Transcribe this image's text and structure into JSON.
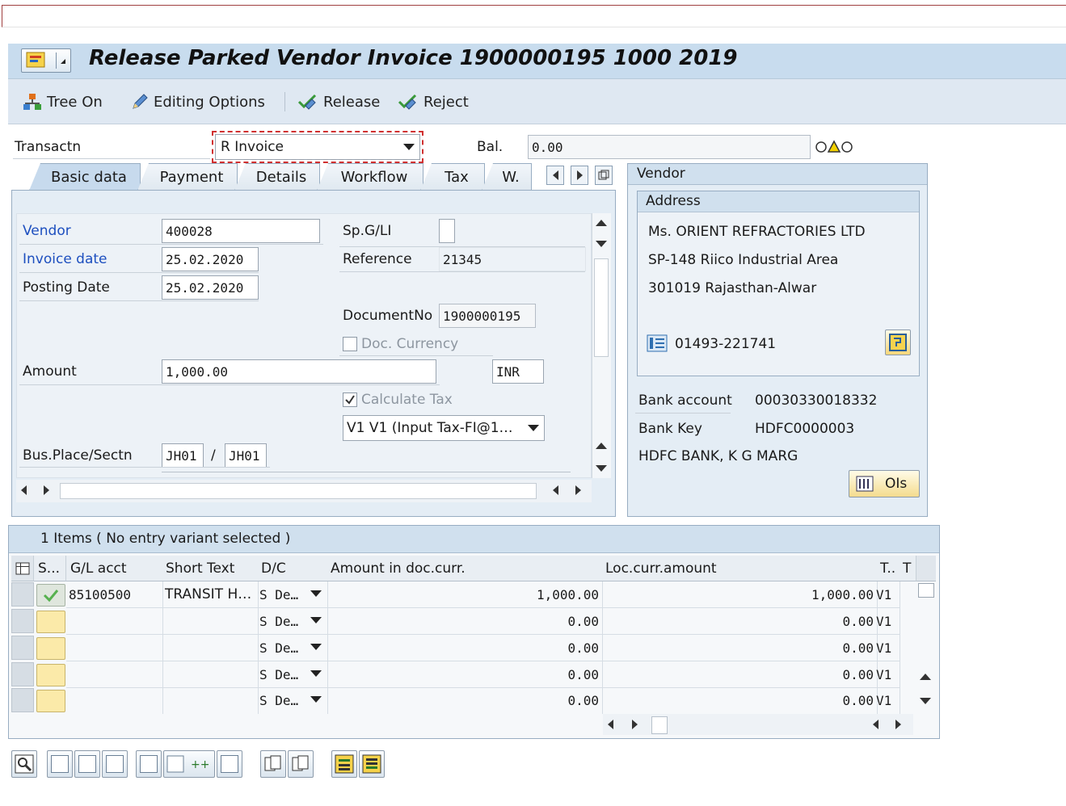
{
  "title": "Release Parked Vendor Invoice 1900000195 1000 2019",
  "toolbar": {
    "tree_on": "Tree On",
    "editing_options": "Editing Options",
    "release": "Release",
    "reject": "Reject"
  },
  "header": {
    "transaction_label": "Transactn",
    "transaction_value": "R Invoice",
    "balance_label": "Bal.",
    "balance_value": "0.00"
  },
  "tabs": [
    "Basic data",
    "Payment",
    "Details",
    "Workflow",
    "Tax",
    "W."
  ],
  "basic_data": {
    "vendor_label": "Vendor",
    "vendor_value": "400028",
    "invoice_date_label": "Invoice date",
    "invoice_date_value": "25.02.2020",
    "posting_date_label": "Posting Date",
    "posting_date_value": "25.02.2020",
    "spgl_label": "Sp.G/LI",
    "spgl_value": "",
    "reference_label": "Reference",
    "reference_value": "21345",
    "docno_label": "DocumentNo",
    "docno_value": "1900000195",
    "doc_currency_label": "Doc. Currency",
    "amount_label": "Amount",
    "amount_value": "1,000.00",
    "currency_value": "INR",
    "calc_tax_label": "Calculate Tax",
    "tax_code_value": "V1 V1 (Input Tax-FI@1…",
    "bus_place_label": "Bus.Place/Sectn",
    "bus_place_value": "JH01",
    "bus_place_sep": "/",
    "section_value": "JH01"
  },
  "vendor": {
    "panel_title": "Vendor",
    "address_title": "Address",
    "name": "Ms. ORIENT REFRACTORIES LTD",
    "street": "SP-148 Riico Industrial Area",
    "city": "301019 Rajasthan-Alwar",
    "phone": "01493-221741",
    "bank_account_label": "Bank account",
    "bank_account_value": "00030330018332",
    "bank_key_label": "Bank Key",
    "bank_key_value": "HDFC0000003",
    "bank_name": "HDFC BANK, K G MARG",
    "ois_button": "OIs"
  },
  "items": {
    "title": "1 Items ( No entry variant selected )",
    "columns": [
      "S...",
      "G/L acct",
      "Short Text",
      "D/C",
      "Amount in doc.curr.",
      "Loc.curr.amount",
      "T..",
      "T"
    ],
    "rows": [
      {
        "gl": "85100500",
        "text": "TRANSIT H…",
        "dc": "S De…",
        "amount": "1,000.00",
        "loc": "1,000.00",
        "tax": "V1"
      },
      {
        "gl": "",
        "text": "",
        "dc": "S De…",
        "amount": "0.00",
        "loc": "0.00",
        "tax": "V1"
      },
      {
        "gl": "",
        "text": "",
        "dc": "S De…",
        "amount": "0.00",
        "loc": "0.00",
        "tax": "V1"
      },
      {
        "gl": "",
        "text": "",
        "dc": "S De…",
        "amount": "0.00",
        "loc": "0.00",
        "tax": "V1"
      },
      {
        "gl": "",
        "text": "",
        "dc": "S De…",
        "amount": "0.00",
        "loc": "0.00",
        "tax": "V1"
      }
    ]
  },
  "colors": {
    "title_bar": "#c8dcee",
    "panel": "#e4edf5",
    "link": "#1d4fbf"
  }
}
